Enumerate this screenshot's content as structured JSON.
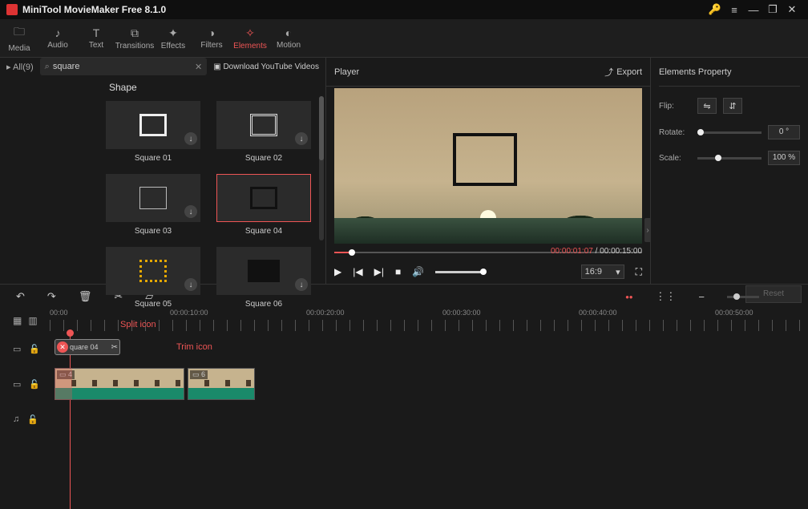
{
  "app": {
    "title": "MiniTool MovieMaker Free 8.1.0"
  },
  "tabs": {
    "media": "Media",
    "audio": "Audio",
    "text": "Text",
    "transitions": "Transitions",
    "effects": "Effects",
    "filters": "Filters",
    "elements": "Elements",
    "motion": "Motion"
  },
  "browser": {
    "tree_label": "All(9)",
    "search_value": "square",
    "download_link": "Download YouTube Videos",
    "section": "Shape",
    "items": [
      "Square 01",
      "Square 02",
      "Square 03",
      "Square 04",
      "Square 05",
      "Square 06"
    ]
  },
  "player": {
    "title": "Player",
    "export": "Export",
    "time_current": "00:00:01:07",
    "time_total": "00:00:15:00",
    "aspect": "16:9"
  },
  "props": {
    "title": "Elements Property",
    "flip": "Flip:",
    "rotate": "Rotate:",
    "scale": "Scale:",
    "rotate_val": "0 °",
    "scale_val": "100 %",
    "reset": "Reset"
  },
  "timeline": {
    "labels": [
      "00:00",
      "00:00:10:00",
      "00:00:20:00",
      "00:00:30:00",
      "00:00:40:00",
      "00:00:50:00"
    ],
    "clip_elem_name": "quare 04",
    "anno_split": "Split icon",
    "anno_trim": "Trim icon",
    "video_tag_a": "4",
    "video_tag_b": "6"
  }
}
